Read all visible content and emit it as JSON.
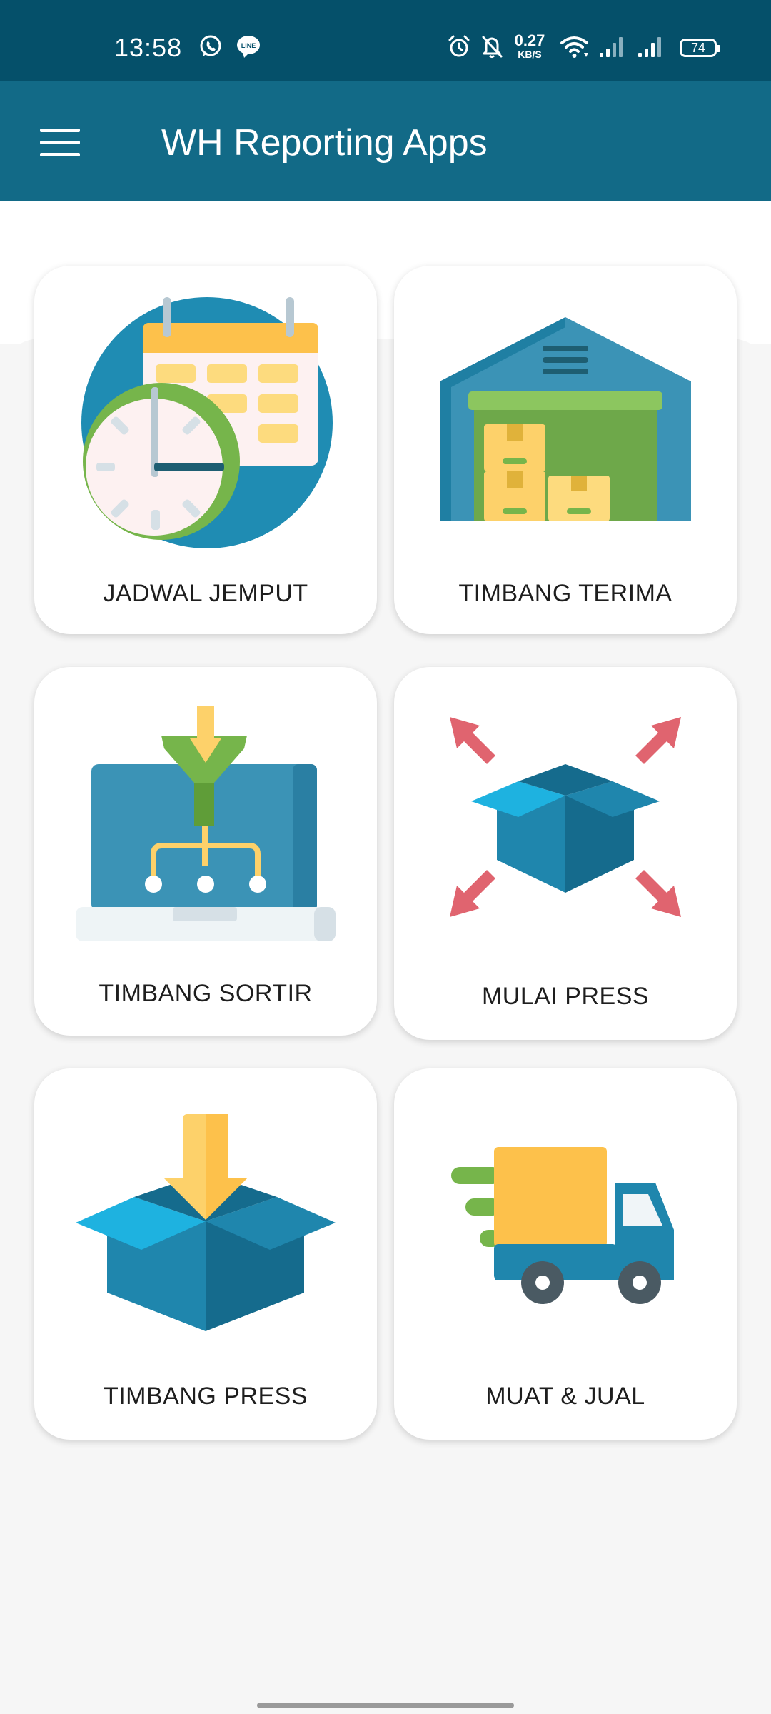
{
  "status_bar": {
    "time": "13:58",
    "speed_value": "0.27",
    "speed_unit": "KB/S",
    "battery": "74",
    "icons": [
      "whatsapp-icon",
      "line-icon",
      "alarm-icon",
      "mute-icon",
      "wifi-icon",
      "signal-icon",
      "signal-icon",
      "battery-icon"
    ]
  },
  "app_bar": {
    "title": "WH Reporting Apps",
    "menu_icon": "hamburger-menu-icon"
  },
  "menu": {
    "items": [
      {
        "label": "JADWAL JEMPUT",
        "icon": "calendar-clock-icon"
      },
      {
        "label": "TIMBANG TERIMA",
        "icon": "warehouse-icon"
      },
      {
        "label": "TIMBANG SORTIR",
        "icon": "laptop-filter-icon"
      },
      {
        "label": "MULAI PRESS",
        "icon": "box-compress-icon"
      },
      {
        "label": "TIMBANG PRESS",
        "icon": "box-down-arrow-icon"
      },
      {
        "label": "MUAT & JUAL",
        "icon": "delivery-truck-icon"
      }
    ]
  },
  "colors": {
    "status_bar": "#05506a",
    "app_bar": "#126a87",
    "card_background": "#ffffff",
    "page_background": "#f6f6f6"
  }
}
